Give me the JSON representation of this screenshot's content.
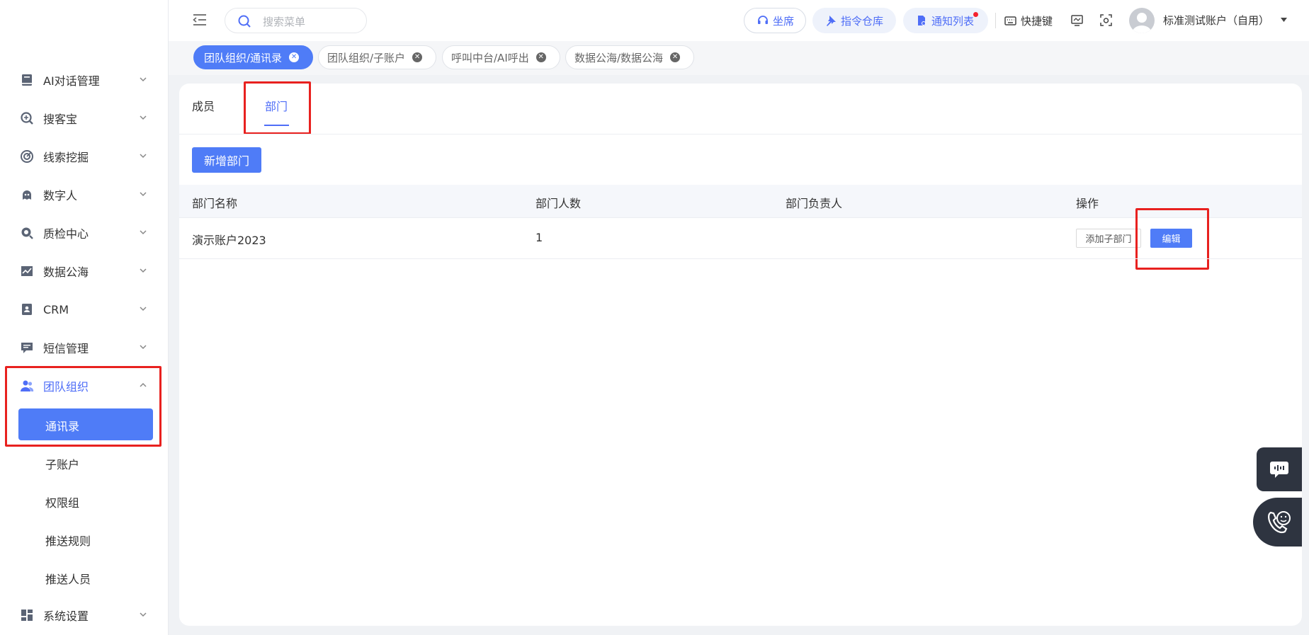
{
  "sidebar": {
    "items": [
      {
        "label": "AI对话管理",
        "icon": "book-icon"
      },
      {
        "label": "搜客宝",
        "icon": "search-plus-icon"
      },
      {
        "label": "线索挖掘",
        "icon": "target-icon"
      },
      {
        "label": "数字人",
        "icon": "robot-icon"
      },
      {
        "label": "质检中心",
        "icon": "magnify-check-icon"
      },
      {
        "label": "数据公海",
        "icon": "chart-icon"
      },
      {
        "label": "CRM",
        "icon": "contact-card-icon"
      },
      {
        "label": "短信管理",
        "icon": "message-icon"
      },
      {
        "label": "团队组织",
        "icon": "team-icon"
      },
      {
        "label": "系统设置",
        "icon": "grid-icon"
      }
    ],
    "sub_items": [
      "通讯录",
      "子账户",
      "权限组",
      "推送规则",
      "推送人员"
    ]
  },
  "header": {
    "search_placeholder": "搜索菜单",
    "buttons": {
      "seat": "坐席",
      "command": "指令仓库",
      "notify": "通知列表"
    },
    "shortcut": "快捷键",
    "user": "标准测试账户（自用）"
  },
  "tags": [
    "团队组织/通讯录",
    "团队组织/子账户",
    "呼叫中台/AI呼出",
    "数据公海/数据公海"
  ],
  "main": {
    "tabs": [
      "成员",
      "部门"
    ],
    "add_button": "新增部门",
    "columns": [
      "部门名称",
      "部门人数",
      "部门负责人",
      "操作"
    ],
    "rows": [
      {
        "name": "演示账户2023",
        "count": "1",
        "leader": "",
        "add_sub": "添加子部门",
        "edit": "编辑"
      }
    ]
  },
  "colors": {
    "accent": "#4f7cf7",
    "highlight": "#e8211f"
  }
}
